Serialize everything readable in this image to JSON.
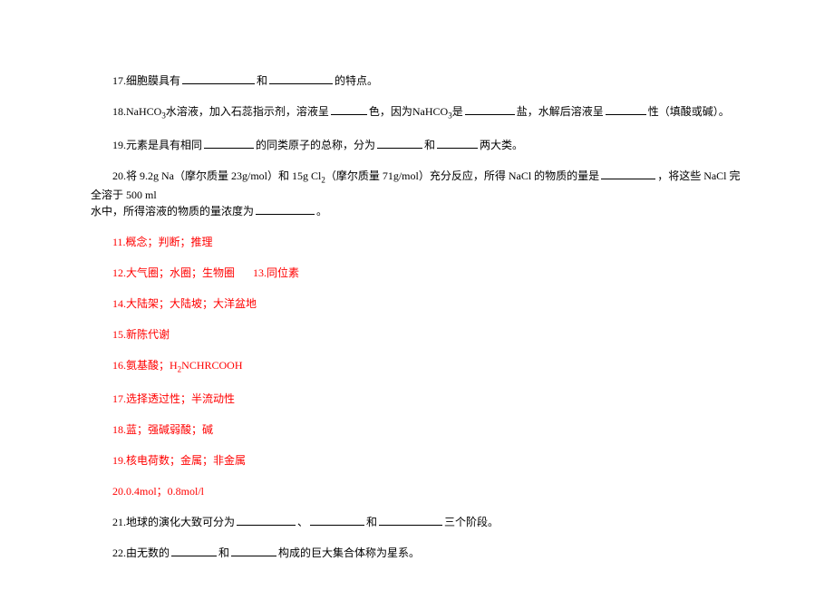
{
  "questions": {
    "q17": {
      "num": "17.",
      "text_a": "细胞膜具有",
      "text_b": "和",
      "text_c": "的特点。"
    },
    "q18": {
      "num": "18.",
      "text_a": "NaHCO",
      "sub_a": "3",
      "text_b": "水溶液，加入石蕊指示剂，溶液呈",
      "text_c": "色，因为NaHCO",
      "sub_b": "3",
      "text_d": "是",
      "text_e": "盐，水解后溶液呈",
      "text_f": "性（填酸或碱）。"
    },
    "q19": {
      "num": "19.",
      "text_a": "元素是具有相同",
      "text_b": "的同类原子的总称，分为",
      "text_c": "和",
      "text_d": "两大类。"
    },
    "q20": {
      "num": "20.",
      "text_a": "将 9.2g Na（摩尔质量 23g/mol）和 15g Cl",
      "sub_a": "2",
      "text_b": "（摩尔质量 71g/mol）充分反应，所得 NaCl 的物质的量是",
      "text_c": "，将这些 NaCl 完全溶于 500 ml",
      "line2_a": "水中，所得溶液的物质的量浓度为",
      "line2_b": "。"
    },
    "q21": {
      "num": "21.",
      "text_a": "地球的演化大致可分为",
      "text_b": "、",
      "text_c": "和",
      "text_d": "三个阶段。"
    },
    "q22": {
      "num": "22.",
      "text_a": "由无数的",
      "text_b": "和",
      "text_c": "构成的巨大集合体称为星系。"
    }
  },
  "answers": {
    "a11": "11.概念；判断；推理",
    "a12_a": "12.大气圈；水圈；生物圈",
    "a12_b": "13.同位素",
    "a14": "14.大陆架；大陆坡；大洋盆地",
    "a15": "15.新陈代谢",
    "a16_a": "16.氨基酸；H",
    "a16_sub": "2",
    "a16_b": "NCHRCOOH",
    "a17": "17.选择透过性；半流动性",
    "a18": "18.蓝；强碱弱酸；碱",
    "a19": "19.核电荷数；金属；非金属",
    "a20": "20.0.4mol；0.8mol/l"
  }
}
